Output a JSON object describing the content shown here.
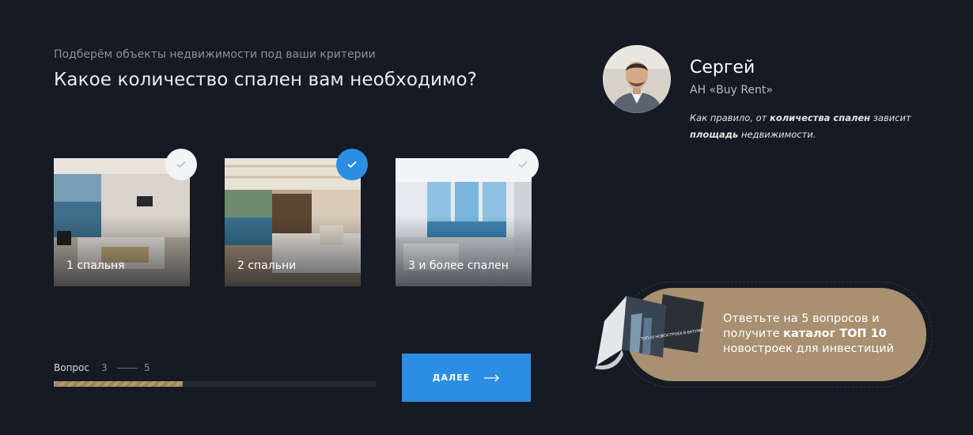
{
  "quiz": {
    "subtitle": "Подберём объекты недвижимости под ваши критерии",
    "question": "Какое количество спален вам необходимо?",
    "options": [
      {
        "label": "1 спальня",
        "selected": false
      },
      {
        "label": "2 спальни",
        "selected": true
      },
      {
        "label": "3 и более спален",
        "selected": false
      }
    ]
  },
  "progress": {
    "label": "Вопрос",
    "current": "3",
    "total": "5",
    "fraction": 0.4
  },
  "next_button": {
    "label": "ДАЛЕЕ"
  },
  "consultant": {
    "name": "Сергей",
    "agency": "АН «Buy Rent»",
    "hint_part1": "Как правило, от ",
    "hint_bold1": "количества спален",
    "hint_part2": " зависит ",
    "hint_bold2": "площадь",
    "hint_part3": " недвижимости."
  },
  "promo": {
    "text_part1": "Ответьте на 5 вопросов и получите ",
    "text_bold": "каталог ТОП 10",
    "text_part2": " новостроек для инвестиций",
    "catalog_cover_text": "ТОП-10 НОВОСТРОЕК В БАТУМИ"
  },
  "colors": {
    "background": "#151a24",
    "accent": "#2c8ee3",
    "gold": "#a89070"
  }
}
